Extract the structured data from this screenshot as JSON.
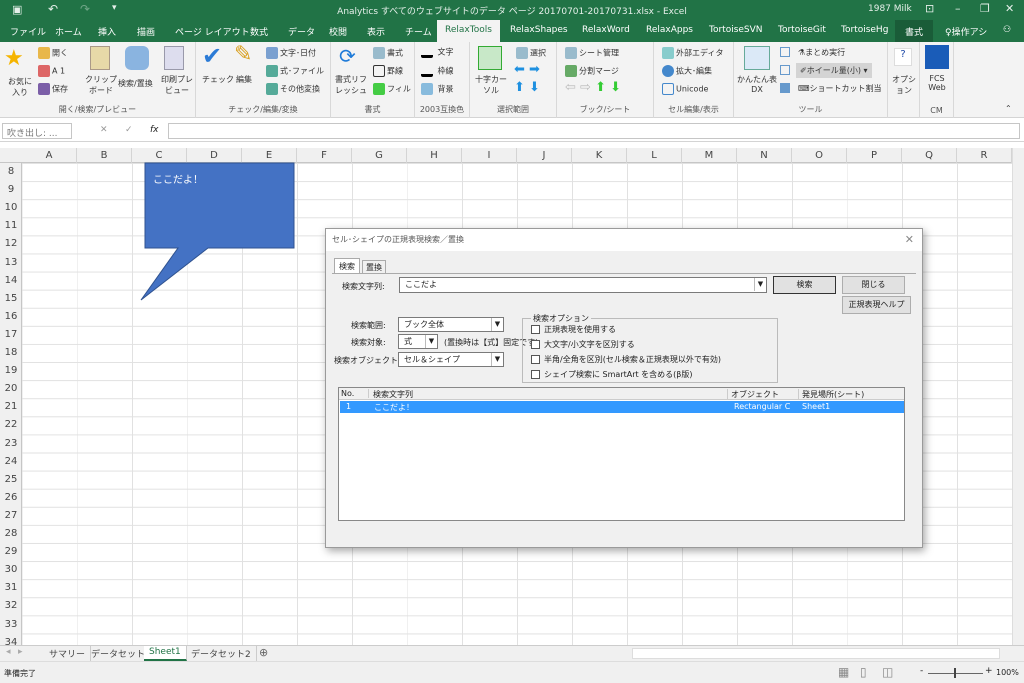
{
  "title": "Analytics すべてのウェブサイトのデータ ページ 20170701-20170731.xlsx  -  Excel",
  "user": "1987 Milk",
  "qat": {
    "save": "save-icon",
    "undo": "undo-icon",
    "redo": "redo-icon",
    "more": "▾"
  },
  "tabs": [
    "ファイル",
    "ホーム",
    "挿入",
    "描画",
    "ページ レイアウト",
    "数式",
    "データ",
    "校閲",
    "表示",
    "チーム",
    "RelaxTools",
    "RelaxShapes",
    "RelaxWord",
    "RelaxApps",
    "TortoiseSVN",
    "TortoiseGit",
    "TortoiseHg",
    "書式"
  ],
  "tell_me": "操作アシ",
  "ribbon": {
    "g1": {
      "label": "開く/検索/プレビュー",
      "fav": "お気に入り",
      "open": "開く",
      "a1": "A 1",
      "save": "保存",
      "clip": "クリップボード",
      "find": "検索/置換",
      "print": "印刷プレビュー"
    },
    "g2": {
      "label": "チェック/編集/変換",
      "check": "チェック",
      "edit": "編集",
      "textdate": "文字･日付",
      "formula": "式･ファイル",
      "other": "その他変換"
    },
    "g3": {
      "label": "書式",
      "refresh": "書式リフレッシュ",
      "fmt": "書式",
      "border": "罫線",
      "fill": "フィル"
    },
    "g4": {
      "label": "2003互換色",
      "text": "文字",
      "frame": "枠線",
      "bg": "背景"
    },
    "g5": {
      "label": "選択範囲",
      "cross": "十字カーソル",
      "select": "選択"
    },
    "g6": {
      "label": "ブック/シート",
      "sheet": "シート管理",
      "split": "分割マージ"
    },
    "g7": {
      "label": "セル編集/表示",
      "ext": "外部エディタ",
      "zoom": "拡大･編集",
      "unicode": "Unicode"
    },
    "g8": {
      "label": "ツール",
      "dx": "かんたん表DX",
      "batch": "まとめ実行",
      "wheel": "ホイール量(小)",
      "shortcut": "ショートカット割当"
    },
    "g9": {
      "label": "",
      "option": "オプション"
    },
    "g10": {
      "label": "CM",
      "fcs": "FCS Web"
    }
  },
  "namebox": "吹き出し: ...",
  "fx": "fx",
  "columns": [
    "A",
    "B",
    "C",
    "D",
    "E",
    "F",
    "G",
    "H",
    "I",
    "J",
    "K",
    "L",
    "M",
    "N",
    "O",
    "P",
    "Q",
    "R"
  ],
  "rows": [
    "8",
    "9",
    "10",
    "11",
    "12",
    "13",
    "14",
    "15",
    "16",
    "17",
    "18",
    "19",
    "20",
    "21",
    "22",
    "23",
    "24",
    "25",
    "26",
    "27",
    "28",
    "29",
    "30",
    "31",
    "32",
    "33",
    "34"
  ],
  "shape": {
    "text": "ここだよ！",
    "fill": "#4472c4"
  },
  "dialog": {
    "title": "セル･シェイプの正規表現検索／置換",
    "tabs": [
      "検索",
      "置換"
    ],
    "search_label": "検索文字列:",
    "search_value": "ここだよ",
    "btn_search": "検索",
    "btn_close": "閉じる",
    "btn_help": "正規表現ヘルプ",
    "range_label": "検索範囲:",
    "range_value": "ブック全体",
    "target_label": "検索対象:",
    "target_value": "式",
    "target_note": "(置換時は【式】固定です)",
    "object_label": "検索オブジェクト:",
    "object_value": "セル＆シェイプ",
    "options_title": "検索オプション",
    "options": [
      {
        "label": "正規表現を使用する",
        "checked": false
      },
      {
        "label": "大文字/小文字を区別する",
        "checked": false
      },
      {
        "label": "半角/全角を区別(セル検索＆正規表現以外で有効)",
        "checked": false
      },
      {
        "label": "シェイプ検索に SmartArt を含める(β版)",
        "checked": false
      }
    ],
    "headers": [
      "No.",
      "検索文字列",
      "オブジェクト",
      "発見場所(シート)"
    ],
    "results": [
      {
        "no": "1",
        "text": "ここだよ！",
        "object": "Rectangular C",
        "sheet": "Sheet1"
      }
    ],
    "highlight": "#3399ff"
  },
  "sheets": [
    "サマリー",
    "データセット1",
    "Sheet1",
    "データセット2"
  ],
  "active_sheet": "Sheet1",
  "status": "準備完了",
  "zoom": "100%",
  "colors": {
    "excel_green": "#217346"
  }
}
